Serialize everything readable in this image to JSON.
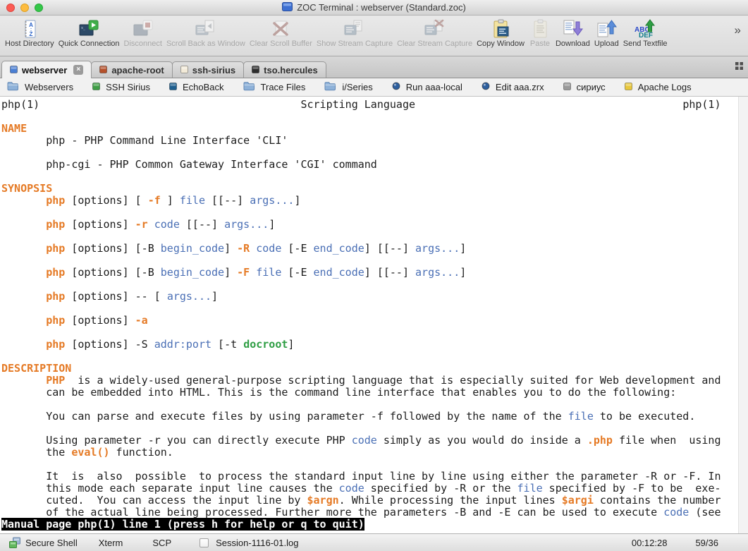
{
  "window": {
    "title": "ZOC Terminal : webserver (Standard.zoc)",
    "traffic_lights": [
      "#fc5c54",
      "#fdbc40",
      "#34c749"
    ]
  },
  "toolbar": {
    "overflow": "»",
    "items": [
      {
        "label": "Host Directory",
        "icon": "host-directory",
        "enabled": true
      },
      {
        "label": "Quick Connection",
        "icon": "quick-connection",
        "enabled": true
      },
      {
        "label": "Disconnect",
        "icon": "disconnect",
        "enabled": false
      },
      {
        "label": "Scroll Back as Window",
        "icon": "scrollback-window",
        "enabled": false
      },
      {
        "label": "Clear Scroll Buffer",
        "icon": "clear-scroll-buffer",
        "enabled": false
      },
      {
        "label": "Show Stream Capture",
        "icon": "show-stream-capture",
        "enabled": false
      },
      {
        "label": "Clear Stream Capture",
        "icon": "clear-stream-capture",
        "enabled": false
      },
      {
        "label": "Copy Window",
        "icon": "copy-window",
        "enabled": true
      },
      {
        "label": "Paste",
        "icon": "paste",
        "enabled": false
      },
      {
        "label": "Download",
        "icon": "download",
        "enabled": true
      },
      {
        "label": "Upload",
        "icon": "upload",
        "enabled": true
      },
      {
        "label": "Send Textfile",
        "icon": "send-textfile",
        "enabled": true
      }
    ]
  },
  "tabs": [
    {
      "label": "webserver",
      "active": true,
      "color": "#4a7fd4",
      "closable": true
    },
    {
      "label": "apache-root",
      "active": false,
      "color": "#b5502a"
    },
    {
      "label": "ssh-sirius",
      "active": false,
      "color": "#f2ead8"
    },
    {
      "label": "tso.hercules",
      "active": false,
      "color": "#2d2d2d"
    }
  ],
  "quickbar": [
    {
      "label": "Webservers",
      "icon": "folder",
      "color": "#8fb2d9"
    },
    {
      "label": "SSH Sirius",
      "icon": "square",
      "color": "#3f9e46"
    },
    {
      "label": "EchoBack",
      "icon": "square",
      "color": "#1f5f8f"
    },
    {
      "label": "Trace Files",
      "icon": "folder",
      "color": "#8fb2d9"
    },
    {
      "label": "i/Series",
      "icon": "folder",
      "color": "#8fb2d9"
    },
    {
      "label": "Run aaa-local",
      "icon": "circle",
      "color": "#2d5f9e"
    },
    {
      "label": "Edit aaa.zrx",
      "icon": "circle",
      "color": "#2d5f9e"
    },
    {
      "label": "сириус",
      "icon": "square",
      "color": "#9a9a9a"
    },
    {
      "label": "Apache Logs",
      "icon": "square",
      "color": "#e8c73c"
    }
  ],
  "terminal": {
    "palette": {
      "default": "#1c1c1c",
      "bold": "#e57a25",
      "underline": "#4a6fb5",
      "special": "#2f9e44",
      "background": "#ffffff"
    },
    "lines": [
      [
        {
          "t": "php(1)"
        },
        {
          "pad": 41
        },
        {
          "t": "Scripting Language"
        },
        {
          "pad": 42
        },
        {
          "t": "php(1)"
        }
      ],
      [],
      [
        {
          "t": "NAME",
          "c": "o"
        }
      ],
      [
        {
          "pad": 7
        },
        {
          "t": "php - PHP Command Line Interface 'CLI'"
        }
      ],
      [],
      [
        {
          "pad": 7
        },
        {
          "t": "php-cgi - PHP Common Gateway Interface 'CGI' command"
        }
      ],
      [],
      [
        {
          "t": "SYNOPSIS",
          "c": "o"
        }
      ],
      [
        {
          "pad": 7
        },
        {
          "t": "php",
          "c": "o"
        },
        {
          "t": " [options] [ "
        },
        {
          "t": "-f",
          "c": "o"
        },
        {
          "t": " ] "
        },
        {
          "t": "file",
          "c": "b"
        },
        {
          "t": " [[--] "
        },
        {
          "t": "args...",
          "c": "b"
        },
        {
          "t": "]"
        }
      ],
      [],
      [
        {
          "pad": 7
        },
        {
          "t": "php",
          "c": "o"
        },
        {
          "t": " [options] "
        },
        {
          "t": "-r",
          "c": "o"
        },
        {
          "t": " "
        },
        {
          "t": "code",
          "c": "b"
        },
        {
          "t": " [[--] "
        },
        {
          "t": "args...",
          "c": "b"
        },
        {
          "t": "]"
        }
      ],
      [],
      [
        {
          "pad": 7
        },
        {
          "t": "php",
          "c": "o"
        },
        {
          "t": " [options] [-B "
        },
        {
          "t": "begin_code",
          "c": "b"
        },
        {
          "t": "] "
        },
        {
          "t": "-R",
          "c": "o"
        },
        {
          "t": " "
        },
        {
          "t": "code",
          "c": "b"
        },
        {
          "t": " [-E "
        },
        {
          "t": "end_code",
          "c": "b"
        },
        {
          "t": "] [[--] "
        },
        {
          "t": "args...",
          "c": "b"
        },
        {
          "t": "]"
        }
      ],
      [],
      [
        {
          "pad": 7
        },
        {
          "t": "php",
          "c": "o"
        },
        {
          "t": " [options] [-B "
        },
        {
          "t": "begin_code",
          "c": "b"
        },
        {
          "t": "] "
        },
        {
          "t": "-F",
          "c": "o"
        },
        {
          "t": " "
        },
        {
          "t": "file",
          "c": "b"
        },
        {
          "t": " [-E "
        },
        {
          "t": "end_code",
          "c": "b"
        },
        {
          "t": "] [[--] "
        },
        {
          "t": "args...",
          "c": "b"
        },
        {
          "t": "]"
        }
      ],
      [],
      [
        {
          "pad": 7
        },
        {
          "t": "php",
          "c": "o"
        },
        {
          "t": " [options] -- [ "
        },
        {
          "t": "args...",
          "c": "b"
        },
        {
          "t": "]"
        }
      ],
      [],
      [
        {
          "pad": 7
        },
        {
          "t": "php",
          "c": "o"
        },
        {
          "t": " [options] "
        },
        {
          "t": "-a",
          "c": "o"
        }
      ],
      [],
      [
        {
          "pad": 7
        },
        {
          "t": "php",
          "c": "o"
        },
        {
          "t": " [options] -S "
        },
        {
          "t": "addr:port",
          "c": "b"
        },
        {
          "t": " [-t "
        },
        {
          "t": "docroot",
          "c": "g"
        },
        {
          "t": "]"
        }
      ],
      [],
      [
        {
          "t": "DESCRIPTION",
          "c": "o"
        }
      ],
      [
        {
          "pad": 7
        },
        {
          "t": "PHP",
          "c": "o"
        },
        {
          "t": "  is a widely-used general-purpose scripting language that is especially suited for Web development and"
        }
      ],
      [
        {
          "pad": 7
        },
        {
          "t": "can be embedded into HTML. This is the command line interface that enables you to do the following:"
        }
      ],
      [],
      [
        {
          "pad": 7
        },
        {
          "t": "You can parse and execute files by using parameter -f followed by the name of the "
        },
        {
          "t": "file",
          "c": "b"
        },
        {
          "t": " to be executed."
        }
      ],
      [],
      [
        {
          "pad": 7
        },
        {
          "t": "Using parameter -r you can directly execute PHP "
        },
        {
          "t": "code",
          "c": "b"
        },
        {
          "t": " simply as you would do inside a "
        },
        {
          "t": ".php",
          "c": "o"
        },
        {
          "t": " file when  using"
        }
      ],
      [
        {
          "pad": 7
        },
        {
          "t": "the "
        },
        {
          "t": "eval()",
          "c": "o"
        },
        {
          "t": " function."
        }
      ],
      [],
      [
        {
          "pad": 7
        },
        {
          "t": "It  is  also  possible  to process the standard input line by line using either the parameter -R or -F. In"
        }
      ],
      [
        {
          "pad": 7
        },
        {
          "t": "this mode each separate input line causes the "
        },
        {
          "t": "code",
          "c": "b"
        },
        {
          "t": " specified by -R or the "
        },
        {
          "t": "file",
          "c": "b"
        },
        {
          "t": " specified by -F to be  exe-"
        }
      ],
      [
        {
          "pad": 7
        },
        {
          "t": "cuted.  You can access the input line by "
        },
        {
          "t": "$argn",
          "c": "o"
        },
        {
          "t": ". While processing the input lines "
        },
        {
          "t": "$argi",
          "c": "o"
        },
        {
          "t": " contains the number"
        }
      ],
      [
        {
          "pad": 7
        },
        {
          "t": "of the actual line being processed. Further more the parameters -B and -E can be used to execute "
        },
        {
          "t": "code",
          "c": "b"
        },
        {
          "t": " (see"
        }
      ],
      [
        {
          "t": "Manual page php(1) line 1 (press h for help or q to quit)",
          "c": "inv"
        }
      ]
    ]
  },
  "statusbar": {
    "protocol": "Secure Shell",
    "emulation": "Xterm",
    "transfer": "SCP",
    "log_label": "Session-1116-01.log",
    "time": "00:12:28",
    "position": "59/36"
  }
}
